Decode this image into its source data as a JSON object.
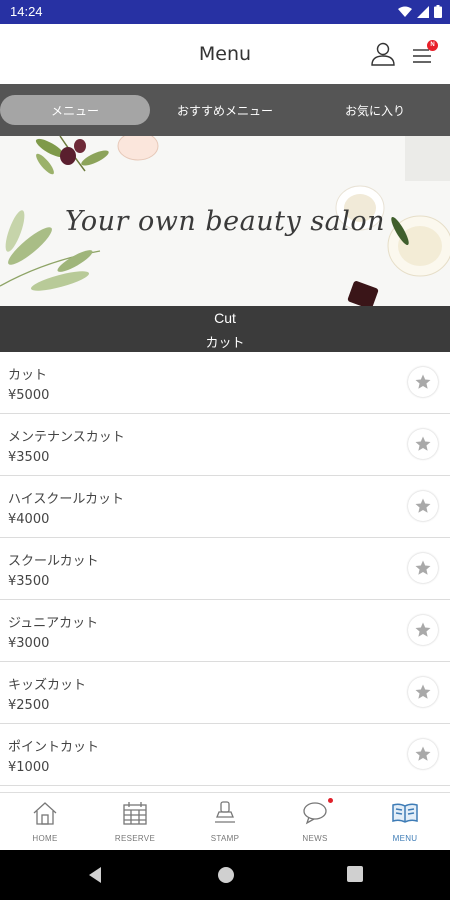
{
  "status_bar": {
    "time": "14:24"
  },
  "header": {
    "title": "Menu",
    "badge": "N"
  },
  "tabs": [
    {
      "label": "メニュー",
      "active": true
    },
    {
      "label": "おすすめメニュー",
      "active": false
    },
    {
      "label": "お気に入り",
      "active": false
    }
  ],
  "banner": {
    "text": "Your own beauty salon"
  },
  "category": {
    "title_en": "Cut",
    "title_jp": "カット"
  },
  "items": [
    {
      "name": "カット",
      "price": "¥5000"
    },
    {
      "name": "メンテナンスカット",
      "price": "¥3500"
    },
    {
      "name": "ハイスクールカット",
      "price": "¥4000"
    },
    {
      "name": "スクールカット",
      "price": "¥3500"
    },
    {
      "name": "ジュニアカット",
      "price": "¥3000"
    },
    {
      "name": "キッズカット",
      "price": "¥2500"
    },
    {
      "name": "ポイントカット",
      "price": "¥1000"
    }
  ],
  "bottom_nav": [
    {
      "label": "HOME",
      "icon": "home-icon"
    },
    {
      "label": "RESERVE",
      "icon": "calendar-icon"
    },
    {
      "label": "STAMP",
      "icon": "stamp-icon"
    },
    {
      "label": "NEWS",
      "icon": "speech-bubble-icon"
    },
    {
      "label": "MENU",
      "icon": "book-icon",
      "active": true
    }
  ],
  "colors": {
    "status_bar": "#2731a3",
    "tab_bar": "#555555",
    "category_bar": "#3b3b3b",
    "accent": "#3e7cb6",
    "badge": "#e8202a"
  }
}
